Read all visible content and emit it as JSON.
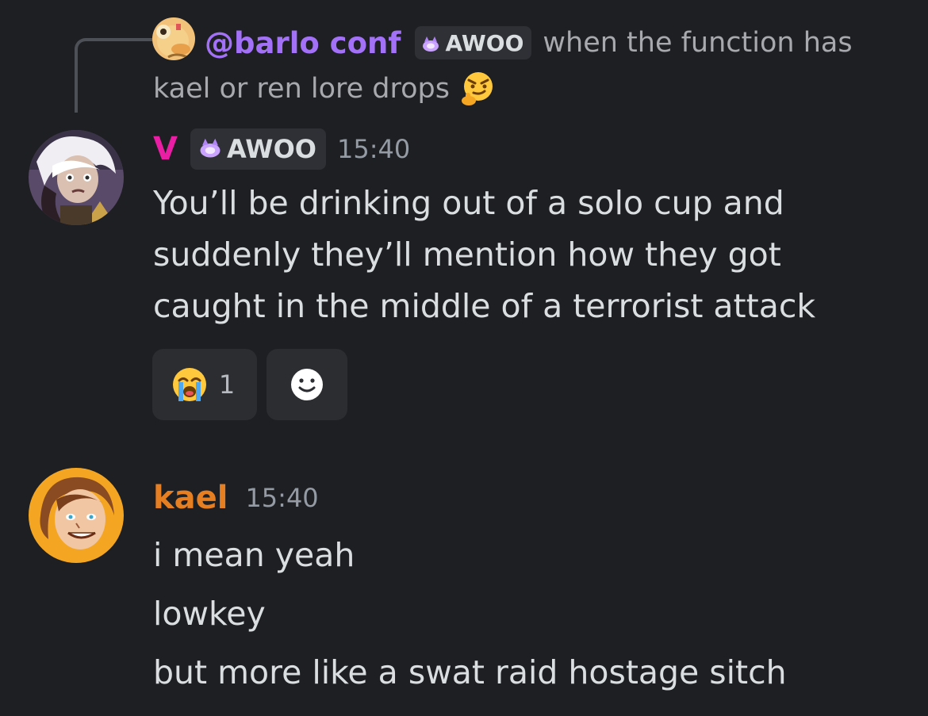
{
  "reply": {
    "author": "@barlo conf",
    "role_tag": "AWOO",
    "text_part1": "when the function has",
    "text_part2": "kael or ren lore drops"
  },
  "messages": [
    {
      "author": "V",
      "role_tag": "AWOO",
      "timestamp": "15:40",
      "lines": [
        "You’ll be drinking out of a solo cup and",
        "suddenly they’ll mention how they got",
        "caught in the middle of a terrorist attack"
      ],
      "reactions": [
        {
          "emoji": "crying-face",
          "count": "1"
        }
      ]
    },
    {
      "author": "kael",
      "timestamp": "15:40",
      "lines": [
        "i mean yeah",
        "lowkey",
        "but more like a swat raid hostage sitch"
      ]
    }
  ],
  "colors": {
    "background": "#1e1f22",
    "reply_author": "#a371f7",
    "author_v": "#e91ea5",
    "author_kael": "#e67e22",
    "text": "#dbdee1",
    "muted": "#949ba4"
  }
}
